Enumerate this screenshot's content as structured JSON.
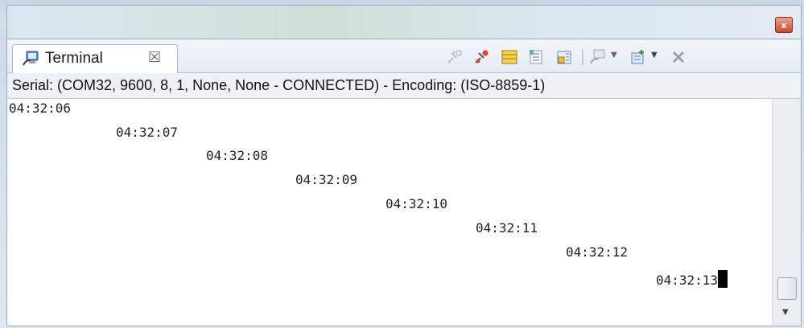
{
  "window": {
    "close_glyph": "x"
  },
  "tab": {
    "label": "Terminal",
    "close_glyph": "☒",
    "icon": "terminal-icon"
  },
  "toolbar": {
    "icons": [
      "connect-icon",
      "disconnect-icon",
      "settings-icon",
      "scroll-lock-icon",
      "clear-icon",
      "new-terminal-icon",
      "pin-icon",
      "remove-icon"
    ]
  },
  "status": {
    "text": "Serial: (COM32, 9600, 8, 1, None, None - CONNECTED) - Encoding: (ISO-8859-1)"
  },
  "terminal": {
    "lines": [
      "04:32:06",
      "04:32:07",
      "04:32:08",
      "04:32:09",
      "04:32:10",
      "04:32:11",
      "04:32:12",
      "04:32:13"
    ]
  },
  "colors": {
    "accent": "#c9482d",
    "tab_border": "#a9b7ca"
  }
}
